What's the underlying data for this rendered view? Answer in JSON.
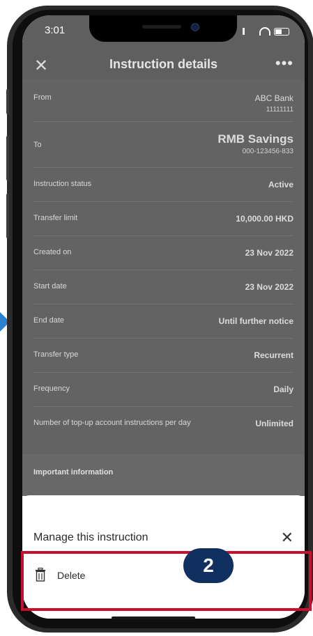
{
  "status_bar": {
    "time": "3:01"
  },
  "header": {
    "title": "Instruction details",
    "close_icon": "close-icon",
    "more_icon": "more-icon"
  },
  "details": [
    {
      "label": "From",
      "value": "ABC Bank",
      "sub": "11111111"
    },
    {
      "label": "To",
      "value": "RMB Savings",
      "sub": "000-123456-833"
    },
    {
      "label": "Instruction status",
      "value": "Active"
    },
    {
      "label": "Transfer limit",
      "value": "10,000.00 HKD"
    },
    {
      "label": "Created on",
      "value": "23 Nov 2022"
    },
    {
      "label": "Start date",
      "value": "23 Nov 2022"
    },
    {
      "label": "End date",
      "value": "Until further notice"
    },
    {
      "label": "Transfer type",
      "value": "Recurrent"
    },
    {
      "label": "Frequency",
      "value": "Daily"
    },
    {
      "label": "Number of top-up account instructions per day",
      "value": "Unlimited"
    }
  ],
  "important_info": "Important information",
  "sheet": {
    "heading": "Manage this instruction",
    "delete_label": "Delete"
  },
  "annotation": {
    "step_number": "2",
    "highlight_color": "#c8102e",
    "badge_color": "#10305f"
  }
}
